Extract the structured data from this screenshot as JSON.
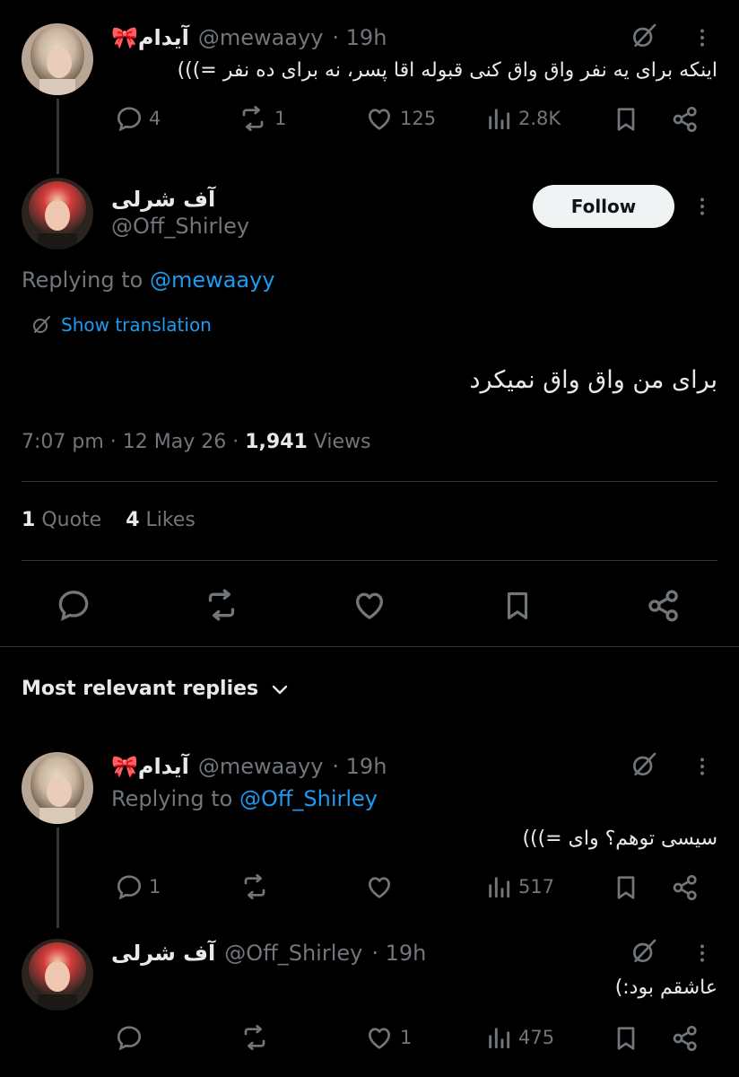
{
  "tweet1": {
    "name": "آیدام🎀",
    "handle": "@mewaayy",
    "time": "· 19h",
    "text": "اینکه برای یه نفر واق واق کنی قبوله اقا پسر، نه برای ده نفر =)))",
    "replies": "4",
    "retweets": "1",
    "likes": "125",
    "views": "2.8K"
  },
  "main": {
    "name": "آف شرلی",
    "handle": "@Off_Shirley",
    "follow_label": "Follow",
    "replying_prefix": "Replying to",
    "replying_handle": "@mewaayy",
    "show_translation": "Show translation",
    "text": "برای من واق واق نمیکرد",
    "timestamp": "7:07 pm · 12 May 26 ·",
    "views_count": "1,941",
    "views_label": "Views",
    "quotes_count": "1",
    "quotes_label": "Quote",
    "likes_count": "4",
    "likes_label": "Likes"
  },
  "sort": {
    "label": "Most relevant replies"
  },
  "reply1": {
    "name": "آیدام🎀",
    "handle": "@mewaayy",
    "time": "· 19h",
    "replying_prefix": "Replying to",
    "replying_handle": "@Off_Shirley",
    "text": "سیسی توهم؟ وای =)))",
    "replies": "1",
    "views": "517"
  },
  "reply2": {
    "name": "آف شرلی",
    "handle": "@Off_Shirley",
    "time": "· 19h",
    "text": "عاشقم بود:)",
    "likes": "1",
    "views": "475"
  },
  "colors": {
    "background": "#000000",
    "text": "#e7e9ea",
    "secondary": "#71767b",
    "accent": "#1d9bf0"
  }
}
